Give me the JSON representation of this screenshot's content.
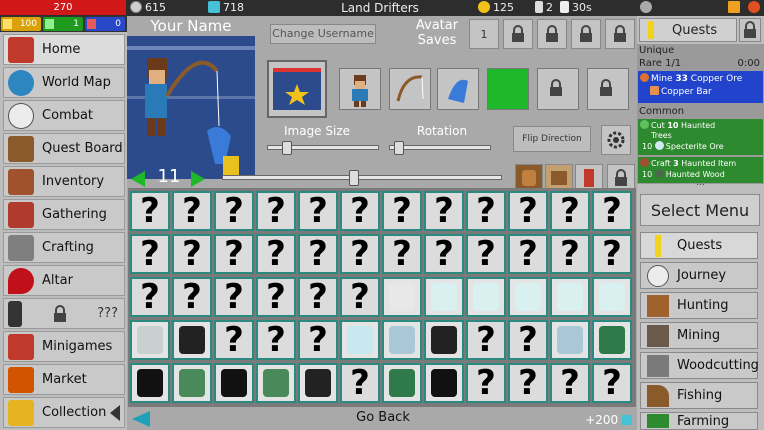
{
  "topbar": {
    "health": "270",
    "coins": "615",
    "gems": "718",
    "title": "Land Drifters",
    "suns": "125",
    "unlocks": "2",
    "timer": "30s",
    "energy": "100",
    "green_res": "1",
    "blue_res": "0"
  },
  "nav": {
    "items": [
      {
        "label": "Home",
        "icon": "home-icon"
      },
      {
        "label": "World Map",
        "icon": "globe-icon"
      },
      {
        "label": "Combat",
        "icon": "skull-icon"
      },
      {
        "label": "Quest Board",
        "icon": "board-icon"
      },
      {
        "label": "Inventory",
        "icon": "backpack-icon"
      },
      {
        "label": "Gathering",
        "icon": "gather-icon"
      },
      {
        "label": "Crafting",
        "icon": "tools-icon"
      },
      {
        "label": "Altar",
        "icon": "blood-drop-icon"
      },
      {
        "label": "???",
        "icon": "lightning-icon"
      },
      {
        "label": "Minigames",
        "icon": "arcade-icon"
      },
      {
        "label": "Market",
        "icon": "shop-icon"
      },
      {
        "label": "Collection",
        "icon": "trophy-icon"
      }
    ]
  },
  "profile": {
    "name": "Your Name",
    "change_username": "Change Username",
    "avatar_saves": "Avatar\nSaves",
    "save_slot": "1",
    "image_size_label": "Image Size",
    "rotation_label": "Rotation",
    "flip_label": "Flip Direction",
    "page_number": "11",
    "image_size": 0.15,
    "rotation": 0.05,
    "page_slider": 0.47
  },
  "grid": {
    "unknown": "?"
  },
  "bottombar": {
    "go_back": "Go Back",
    "bonus": "+200"
  },
  "quests": {
    "title": "Quests",
    "unique_label": "Unique",
    "rare_label": "Rare 1/1",
    "rare_timer": "0:00",
    "rare_task_prefix": "Mine",
    "rare_task_amount": "33",
    "rare_task_item": "Copper Ore",
    "rare_reward": "Copper Bar",
    "common_label": "Common",
    "common": [
      {
        "prefix": "Cut",
        "amount": "10",
        "item": "Haunted",
        "item2": "Trees",
        "reward_count": "10",
        "reward": "Specterite Ore"
      },
      {
        "prefix": "Craft",
        "amount": "3",
        "item": "Haunted Item",
        "reward_count": "10",
        "reward": "Haunted Wood"
      }
    ],
    "more": "...",
    "select_menu": "Select Menu",
    "menu": [
      "Quests",
      "Journey",
      "Hunting",
      "Mining",
      "Woodcutting",
      "Fishing",
      "Farming"
    ]
  },
  "colors": {
    "accent_green": "#1fb82a",
    "quest_blue": "#2244cc",
    "quest_green": "#2e8a2e",
    "slot_border": "#2a8a80"
  }
}
